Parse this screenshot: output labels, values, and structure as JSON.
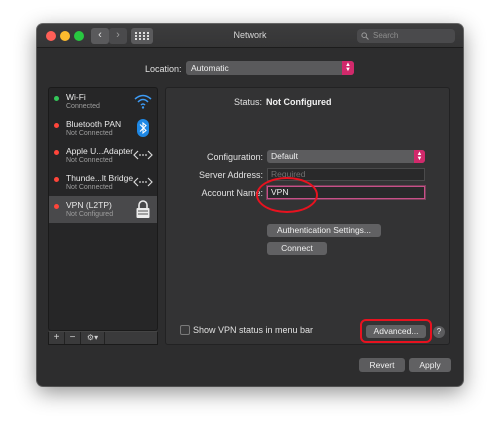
{
  "window": {
    "title": "Network"
  },
  "search": {
    "placeholder": "Search"
  },
  "location": {
    "label": "Location:",
    "value": "Automatic"
  },
  "services": [
    {
      "name": "Wi-Fi",
      "status": "Connected",
      "dot_color": "#34c759",
      "icon": "wifi-icon"
    },
    {
      "name": "Bluetooth PAN",
      "status": "Not Connected",
      "dot_color": "#ff453a",
      "icon": "bluetooth-icon"
    },
    {
      "name": "Apple U...Adapter",
      "status": "Not Connected",
      "dot_color": "#ff453a",
      "icon": "ethernet-icon"
    },
    {
      "name": "Thunde...lt Bridge",
      "status": "Not Connected",
      "dot_color": "#ff453a",
      "icon": "ethernet-icon"
    },
    {
      "name": "VPN (L2TP)",
      "status": "Not Configured",
      "dot_color": "#ff453a",
      "icon": "vpn-lock-icon"
    }
  ],
  "sidebar_toolbar": {
    "add": "+",
    "remove": "−",
    "gear": "⚙▾"
  },
  "details": {
    "status_label": "Status:",
    "status_value": "Not Configured",
    "configuration_label": "Configuration:",
    "configuration_value": "Default",
    "server_address_label": "Server Address:",
    "server_address_placeholder": "Required",
    "account_name_label": "Account Name:",
    "account_name_value": "VPN",
    "auth_settings_button": "Authentication Settings...",
    "connect_button": "Connect",
    "show_vpn_status_label": "Show VPN status in menu bar",
    "advanced_button": "Advanced...",
    "help_button": "?"
  },
  "footer": {
    "revert": "Revert",
    "apply": "Apply"
  },
  "colors": {
    "accent": "#d1296b",
    "annotation": "#e8121f"
  }
}
